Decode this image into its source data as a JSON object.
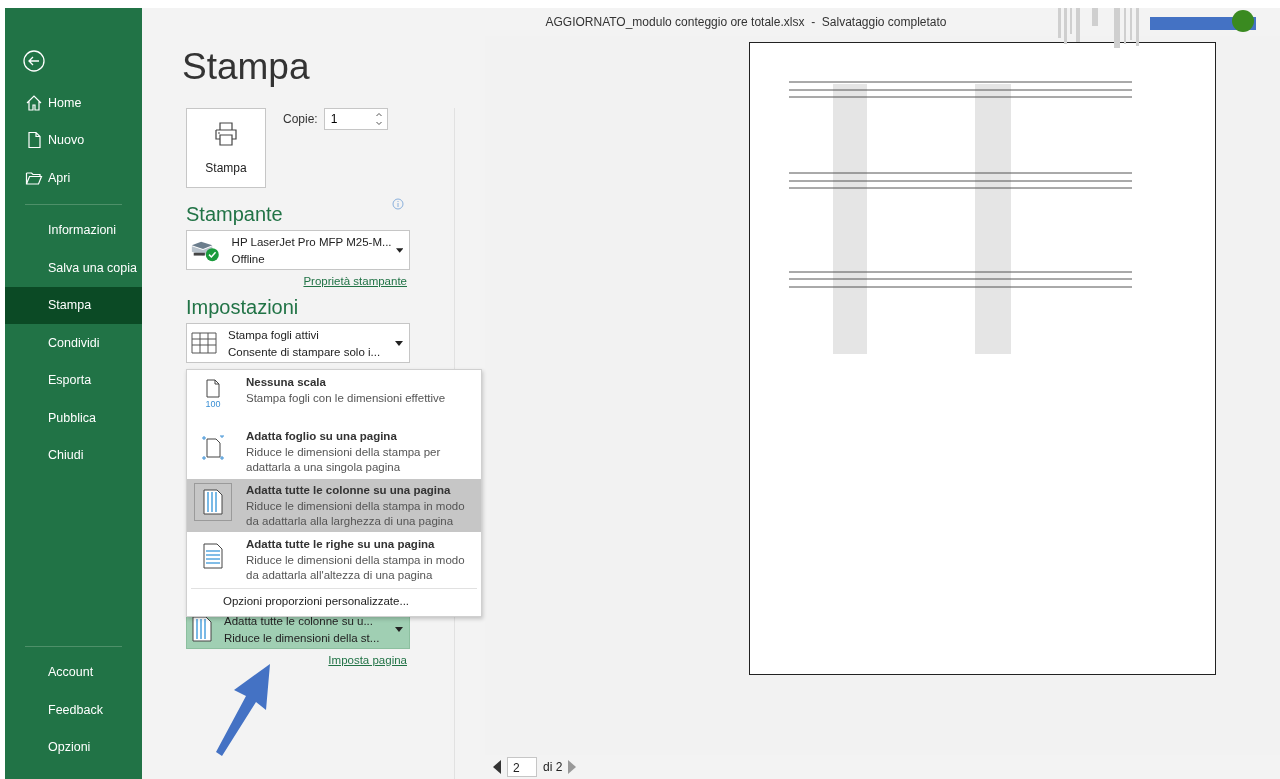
{
  "window": {
    "title": "AGGIORNATO_modulo conteggio ore totale.xlsx  -  Salvataggio completato"
  },
  "sidebar": {
    "top_items": [
      {
        "label": "Home",
        "kind": "home",
        "selected": false
      },
      {
        "label": "Nuovo",
        "kind": "new",
        "selected": false
      },
      {
        "label": "Apri",
        "kind": "open",
        "selected": false
      }
    ],
    "items": [
      {
        "label": "Informazioni",
        "selected": false
      },
      {
        "label": "Salva una copia",
        "selected": false
      },
      {
        "label": "Stampa",
        "selected": true
      },
      {
        "label": "Condividi",
        "selected": false
      },
      {
        "label": "Esporta",
        "selected": false
      },
      {
        "label": "Pubblica",
        "selected": false
      },
      {
        "label": "Chiudi",
        "selected": false
      }
    ],
    "bottom_items": [
      {
        "label": "Account",
        "selected": false
      },
      {
        "label": "Feedback",
        "selected": false
      },
      {
        "label": "Opzioni",
        "selected": false
      }
    ]
  },
  "page_title": "Stampa",
  "print_button": {
    "label": "Stampa"
  },
  "copies": {
    "label": "Copie:",
    "value": "1"
  },
  "printer": {
    "heading": "Stampante",
    "name": "HP LaserJet Pro MFP M25-M...",
    "status": "Offline",
    "properties_link": "Proprietà stampante"
  },
  "settings": {
    "heading": "Impostazioni",
    "sheets": {
      "title": "Stampa fogli attivi",
      "subtitle": "Consente di stampare solo i..."
    },
    "scaling": {
      "title": "Adatta tutte le colonne su u...",
      "subtitle": "Riduce le dimensioni della st...",
      "expanded": true
    },
    "page_setup_link": "Imposta pagina"
  },
  "scaling_menu": {
    "options": [
      {
        "kind": "actual",
        "icon_text": "100",
        "title": "Nessuna scala",
        "description": "Stampa fogli con le dimensioni effettive",
        "selected": false
      },
      {
        "kind": "fit-sheet",
        "title": "Adatta foglio su una pagina",
        "description": "Riduce le dimensioni della stampa per adattarla a una singola pagina",
        "selected": false
      },
      {
        "kind": "fit-columns",
        "title": "Adatta tutte le colonne su una pagina",
        "description": "Riduce le dimensioni della stampa in modo da adattarla alla larghezza di una pagina",
        "selected": true
      },
      {
        "kind": "fit-rows",
        "title": "Adatta tutte le righe su una pagina",
        "description": "Riduce le dimensioni della stampa in modo da adattarla all'altezza di una pagina",
        "selected": false
      }
    ],
    "custom_option": "Opzioni proporzioni personalizzate..."
  },
  "preview": {
    "page": "2",
    "total": "di 2"
  }
}
